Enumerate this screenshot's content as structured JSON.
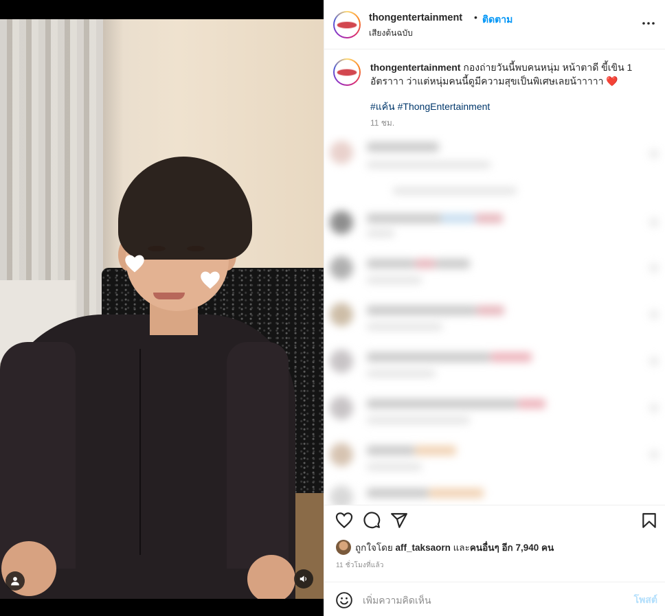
{
  "media": {
    "icons": {
      "tagged": "person-icon",
      "audio": "speaker-icon"
    }
  },
  "post": {
    "username": "thongentertainment",
    "separator": "•",
    "follow_label": "ติดตาม",
    "audio_label": "เสียงต้นฉบับ",
    "caption_text": "กองถ่ายวันนี้พบคนหนุ่ม หน้าตาดี ขี้เขิน 1 อัตราาา ว่าแต่หนุ่มคนนี้ดูมีความสุขเป็นพิเศษเลยน้าาาาา ❤️",
    "hashtags": "#แค้น #ThongEntertainment",
    "caption_time": "11 ชม.",
    "likes": {
      "prefix": "ถูกใจโดย",
      "liker": "aff_taksaorn",
      "middle": "และ",
      "others": "คนอื่นๆ อีก 7,940 คน"
    },
    "posted_ago": "11 ชั่วโมงที่แล้ว",
    "comment_placeholder": "เพิ่มความคิดเห็น",
    "post_button": "โพสต์"
  },
  "colors": {
    "accent_blue": "#0095f6",
    "hashtag_blue": "#00376b",
    "post_disabled": "#b3dffc",
    "muted_text": "#8e8e8e",
    "heart_red": "#ed4956"
  },
  "icons": {
    "more": "more-horizontal-icon",
    "like": "heart-outline-icon",
    "comment": "comment-bubble-icon",
    "share": "paper-plane-icon",
    "save": "bookmark-icon",
    "emoji": "smiley-icon"
  }
}
